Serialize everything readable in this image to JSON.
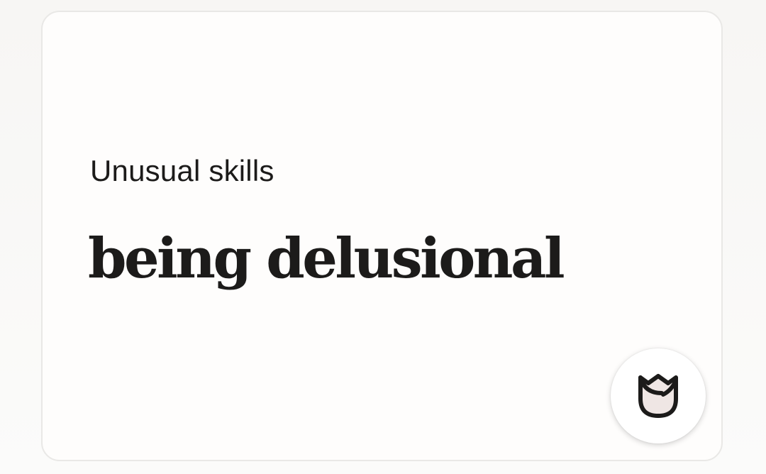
{
  "prompt": {
    "title": "Unusual skills",
    "answer": "being delusional"
  },
  "like_button": {
    "icon": "rose-icon",
    "icon_fill": "#efe6e4",
    "icon_stroke": "#1c1b1a"
  }
}
